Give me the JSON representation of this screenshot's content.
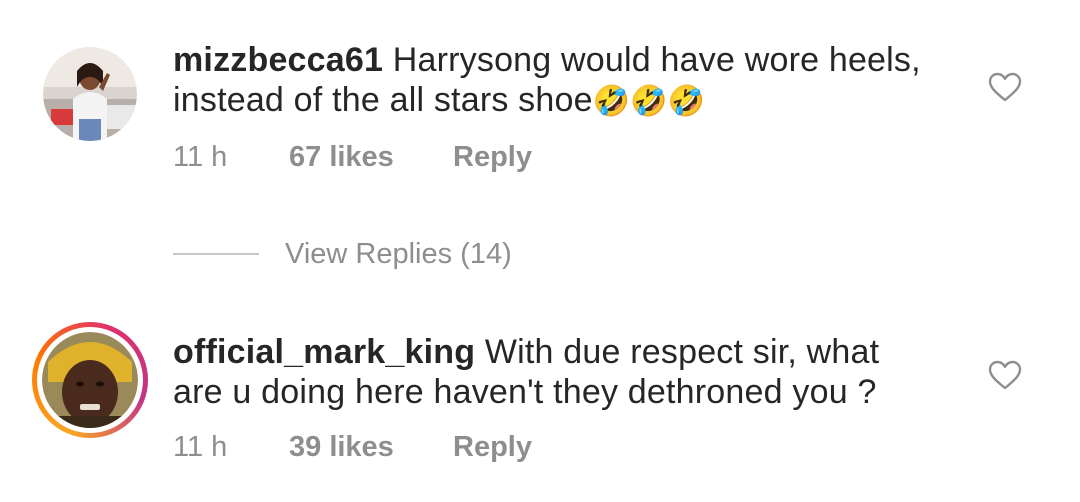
{
  "comments": [
    {
      "username": "mizzbecca61",
      "text": "Harrysong would have wore heels, instead of the all stars shoe",
      "emojis": "🤣🤣🤣",
      "time": "11 h",
      "likes": "67 likes",
      "reply_label": "Reply"
    },
    {
      "username": "official_mark_king",
      "text": "With due respect sir, what are u doing here haven't they dethroned you ?",
      "emojis": "",
      "time": "11 h",
      "likes": "39 likes",
      "reply_label": "Reply"
    }
  ],
  "view_replies": "View Replies (14)",
  "colors": {
    "text": "#262626",
    "muted": "#8e8e8e",
    "divider": "#c7c7c7",
    "story_ring": [
      "#f9a825",
      "#e1306c",
      "#c13584"
    ]
  },
  "icons": {
    "like": "heart-outline-icon"
  }
}
